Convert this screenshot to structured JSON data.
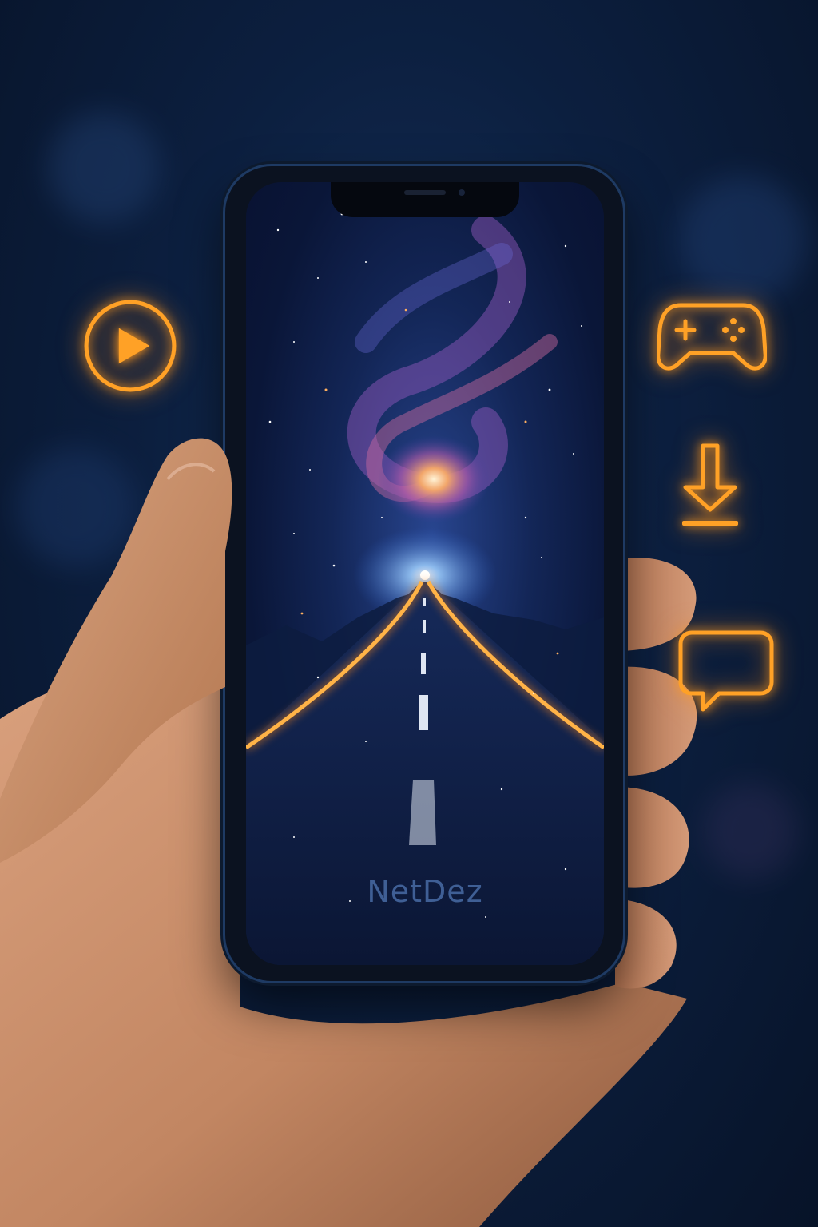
{
  "app": {
    "brand_name": "NetDez"
  },
  "floating_icons": [
    "play-icon",
    "gamepad-icon",
    "download-icon",
    "chat-bubble-icon"
  ],
  "colors": {
    "icon_glow": "#ffa126",
    "background": "#0c1f3f",
    "brand_text": "#3f5f95",
    "road_edge": "#ff9a22"
  }
}
